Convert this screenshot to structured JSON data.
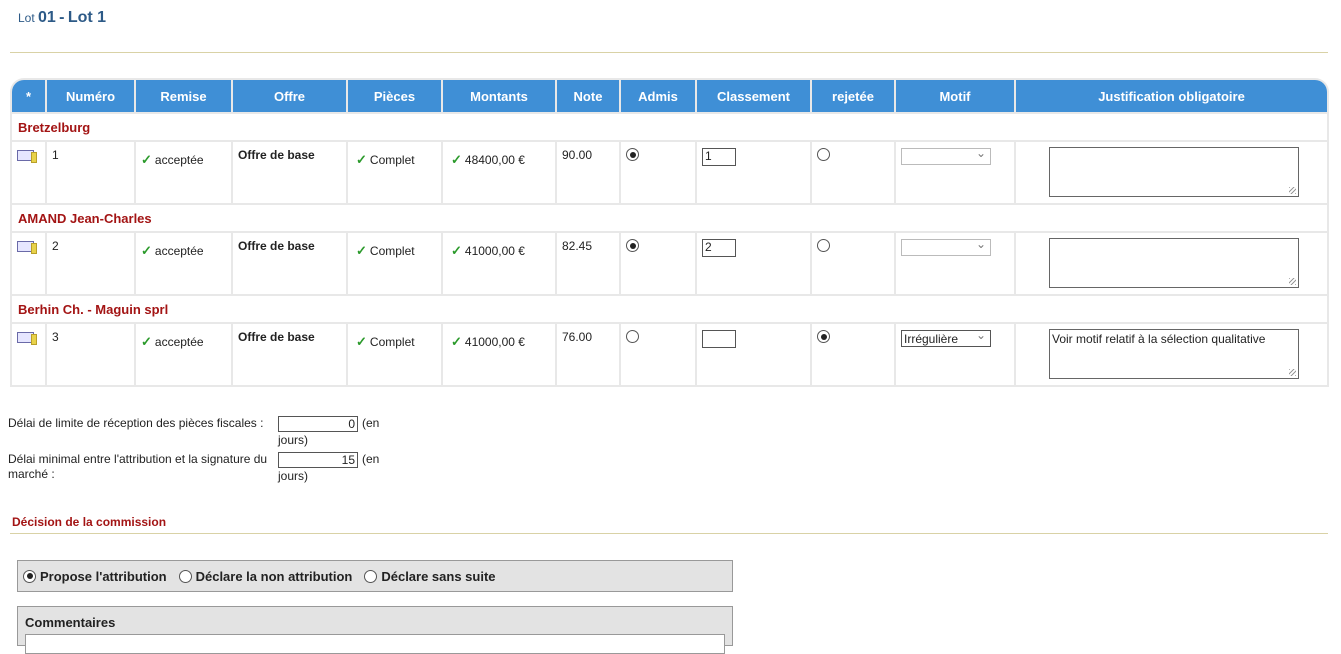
{
  "lot": {
    "prefix": "Lot",
    "number": "01",
    "separator": "-",
    "name": "Lot 1"
  },
  "table": {
    "headers": [
      "*",
      "Numéro",
      "Remise",
      "Offre",
      "Pièces",
      "Montants",
      "Note",
      "Admis",
      "Classement",
      "rejetée",
      "Motif",
      "Justification obligatoire"
    ],
    "groups": [
      {
        "company": "Bretzelburg",
        "numero": "1",
        "remise": "acceptée",
        "offre": "Offre de base",
        "pieces": "Complet",
        "montant": "48400,00 €",
        "note": "90.00",
        "admis": true,
        "classement": "1",
        "rejetee": false,
        "motif": "",
        "justification": ""
      },
      {
        "company": "AMAND Jean-Charles",
        "numero": "2",
        "remise": "acceptée",
        "offre": "Offre de base",
        "pieces": "Complet",
        "montant": "41000,00 €",
        "note": "82.45",
        "admis": true,
        "classement": "2",
        "rejetee": false,
        "motif": "",
        "justification": ""
      },
      {
        "company": "Berhin Ch. - Maguin sprl",
        "numero": "3",
        "remise": "acceptée",
        "offre": "Offre de base",
        "pieces": "Complet",
        "montant": "41000,00 €",
        "note": "76.00",
        "admis": false,
        "classement": "",
        "rejetee": true,
        "motif": "Irrégulière",
        "justification": "Voir motif relatif à la sélection qualitative"
      }
    ]
  },
  "delays": {
    "reception_label": "Délai de limite de réception des pièces fiscales :",
    "reception_value": "0",
    "signature_label": "Délai minimal entre l'attribution et la signature du marché :",
    "signature_value": "15",
    "unit_open": "(en",
    "unit_close": "jours)"
  },
  "decision": {
    "title": "Décision de la commission",
    "options": [
      {
        "label": "Propose l'attribution",
        "selected": true
      },
      {
        "label": "Déclare la non attribution",
        "selected": false
      },
      {
        "label": "Déclare sans suite",
        "selected": false
      }
    ],
    "comments_label": "Commentaires"
  },
  "colors": {
    "header_blue": "#3f8fd6",
    "company_red": "#a31414",
    "title_blue": "#2d5a87",
    "check_green": "#2b9a2b"
  }
}
